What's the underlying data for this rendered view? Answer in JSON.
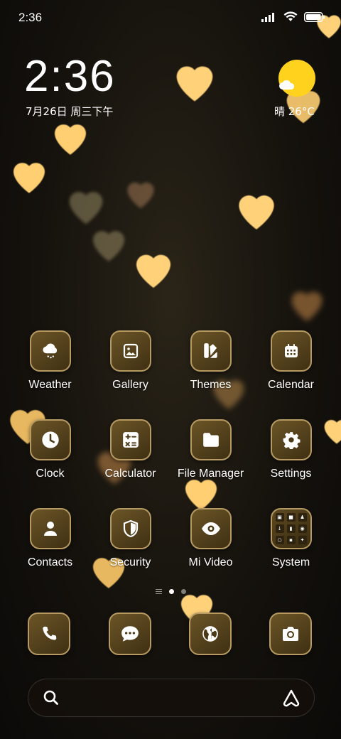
{
  "status_bar": {
    "time": "2:36"
  },
  "clock_widget": {
    "time": "2:36",
    "date": "7月26日 周三下午"
  },
  "weather_widget": {
    "text": "晴 26°C"
  },
  "apps": [
    {
      "label": "Weather",
      "icon": "cloud-rain-icon"
    },
    {
      "label": "Gallery",
      "icon": "image-icon"
    },
    {
      "label": "Themes",
      "icon": "palette-icon"
    },
    {
      "label": "Calendar",
      "icon": "calendar-icon"
    },
    {
      "label": "Clock",
      "icon": "clock-icon"
    },
    {
      "label": "Calculator",
      "icon": "calculator-icon"
    },
    {
      "label": "File Manager",
      "icon": "folder-icon"
    },
    {
      "label": "Settings",
      "icon": "gear-icon"
    },
    {
      "label": "Contacts",
      "icon": "person-icon"
    },
    {
      "label": "Security",
      "icon": "shield-icon"
    },
    {
      "label": "Mi Video",
      "icon": "eye-icon"
    },
    {
      "label": "System",
      "icon": "folder-grid-icon"
    }
  ],
  "dock": [
    {
      "icon": "phone-icon"
    },
    {
      "icon": "message-icon"
    },
    {
      "icon": "globe-icon"
    },
    {
      "icon": "camera-icon"
    }
  ],
  "pages": {
    "count": 2,
    "active": 1
  },
  "colors": {
    "icon_bg": "#5a4620",
    "icon_border": "#b69a62",
    "sun": "#ffd21e",
    "heart": "#ffd27a"
  }
}
